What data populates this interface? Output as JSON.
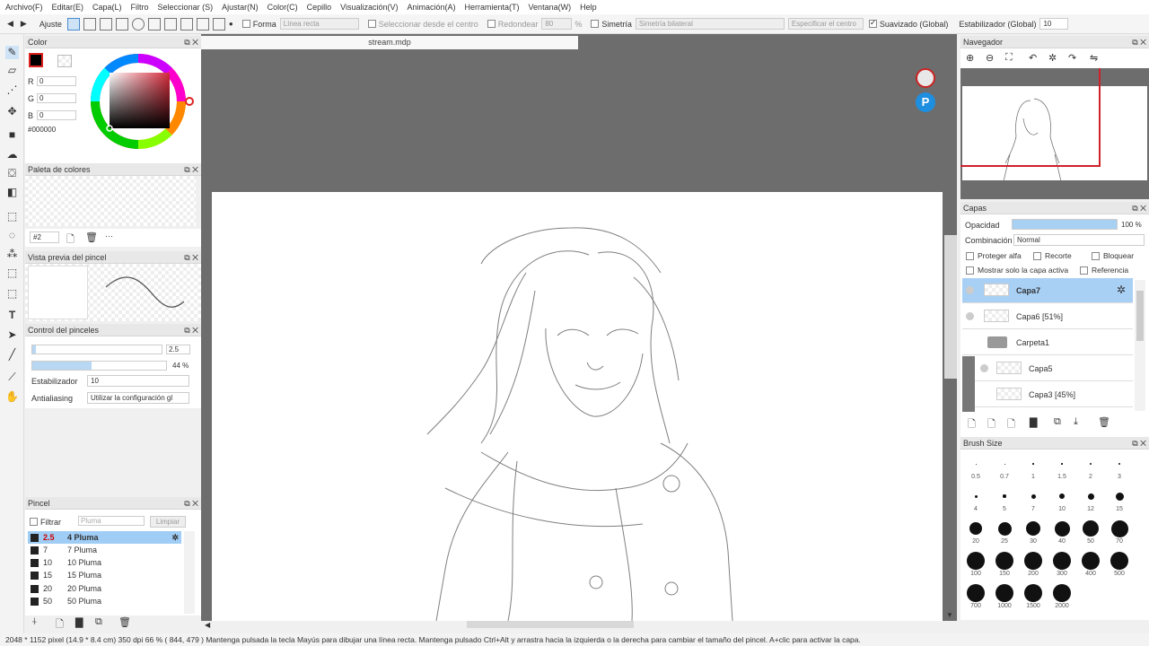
{
  "menu": [
    "Archivo(F)",
    "Editar(E)",
    "Capa(L)",
    "Filtro",
    "Seleccionar (S)",
    "Ajustar(N)",
    "Color(C)",
    "Cepillo",
    "Visualización(V)",
    "Animación(A)",
    "Herramienta(T)",
    "Ventana(W)",
    "Help"
  ],
  "toolbar": {
    "ajuste": "Ajuste",
    "forma": "Forma",
    "forma_value": "Línea recta",
    "seleccionar_centro": "Seleccionar desde el centro",
    "redondear": "Redondear",
    "redondear_value": "80",
    "percent": "%",
    "simetria": "Simetría",
    "simetria_value": "Simetría bilateral",
    "especificar": "Especificar el centro",
    "suavizado": "Suavizado (Global)",
    "estabilizador": "Estabilizador (Global)",
    "estabilizador_value": "10"
  },
  "color_panel": {
    "title": "Color",
    "r_label": "R",
    "r": "0",
    "g_label": "G",
    "g": "0",
    "b_label": "B",
    "b": "0",
    "hex": "#000000",
    "fg": "#000000"
  },
  "palette_panel": {
    "title": "Paleta de colores",
    "selector": "#2"
  },
  "preview_panel": {
    "title": "Vista previa del pincel"
  },
  "brush_control": {
    "title": "Control del pinceles",
    "size": "2.5",
    "size_fraction": 0.03,
    "opacity": "44",
    "opacity_unit": "%",
    "opacity_fraction": 0.44,
    "stabilizer_label": "Estabilizador",
    "stabilizer_value": "10",
    "antialias_label": "Antialiasing",
    "antialias_value": "Utilizar la configuración gl"
  },
  "brush_panel": {
    "title": "Pincel",
    "filter_label": "Filtrar",
    "filter_placeholder": "Pluma",
    "clear": "Limpiar",
    "items": [
      {
        "size": "2.5",
        "name": "4  Pluma",
        "selected": true
      },
      {
        "size": "7",
        "name": "7  Pluma",
        "selected": false
      },
      {
        "size": "10",
        "name": "10  Pluma",
        "selected": false
      },
      {
        "size": "15",
        "name": "15  Pluma",
        "selected": false
      },
      {
        "size": "20",
        "name": "20  Pluma",
        "selected": false
      },
      {
        "size": "50",
        "name": "50  Pluma",
        "selected": false
      }
    ]
  },
  "document": {
    "tab": "stream.mdp"
  },
  "navigator": {
    "title": "Navegador"
  },
  "layers": {
    "title": "Capas",
    "opacity_label": "Opacidad",
    "opacity_value": "100 %",
    "opacity_fraction": 1.0,
    "blend_label": "Combinación",
    "blend_value": "Normal",
    "protect_alpha": "Proteger alfa",
    "clipping": "Recorte",
    "lock": "Bloquear",
    "show_active": "Mostrar solo la capa activa",
    "reference": "Referencia",
    "items": [
      {
        "name": "Capa7",
        "kind": "layer",
        "selected": true
      },
      {
        "name": "Capa6 [51%]",
        "kind": "layer",
        "selected": false
      },
      {
        "name": "Carpeta1",
        "kind": "folder",
        "selected": false
      },
      {
        "name": "Capa5",
        "kind": "layer",
        "selected": false
      },
      {
        "name": "Capa3 [45%]",
        "kind": "layer",
        "selected": false
      }
    ]
  },
  "brush_size": {
    "title": "Brush Size",
    "row1": [
      "0.5",
      "0.7",
      "1",
      "1.5",
      "2",
      "3"
    ],
    "row2": [
      "4",
      "5",
      "7",
      "10",
      "12",
      "15"
    ],
    "row3": [
      "20",
      "25",
      "30",
      "40",
      "50",
      "70"
    ],
    "row4": [
      "100",
      "150",
      "200",
      "300",
      "400",
      "500"
    ],
    "row5": [
      "700",
      "1000",
      "1500",
      "2000"
    ]
  },
  "status": {
    "text": "2048 * 1152 pixel    (14.9 * 8.4 cm)   350 dpi   66 %   ( 844, 479 )   Mantenga pulsada la tecla Mayús para dibujar una línea recta. Mantenga pulsado Ctrl+Alt y arrastra hacia la izquierda o la derecha para cambiar el tamaño del pincel. A+clic para activar la capa."
  }
}
